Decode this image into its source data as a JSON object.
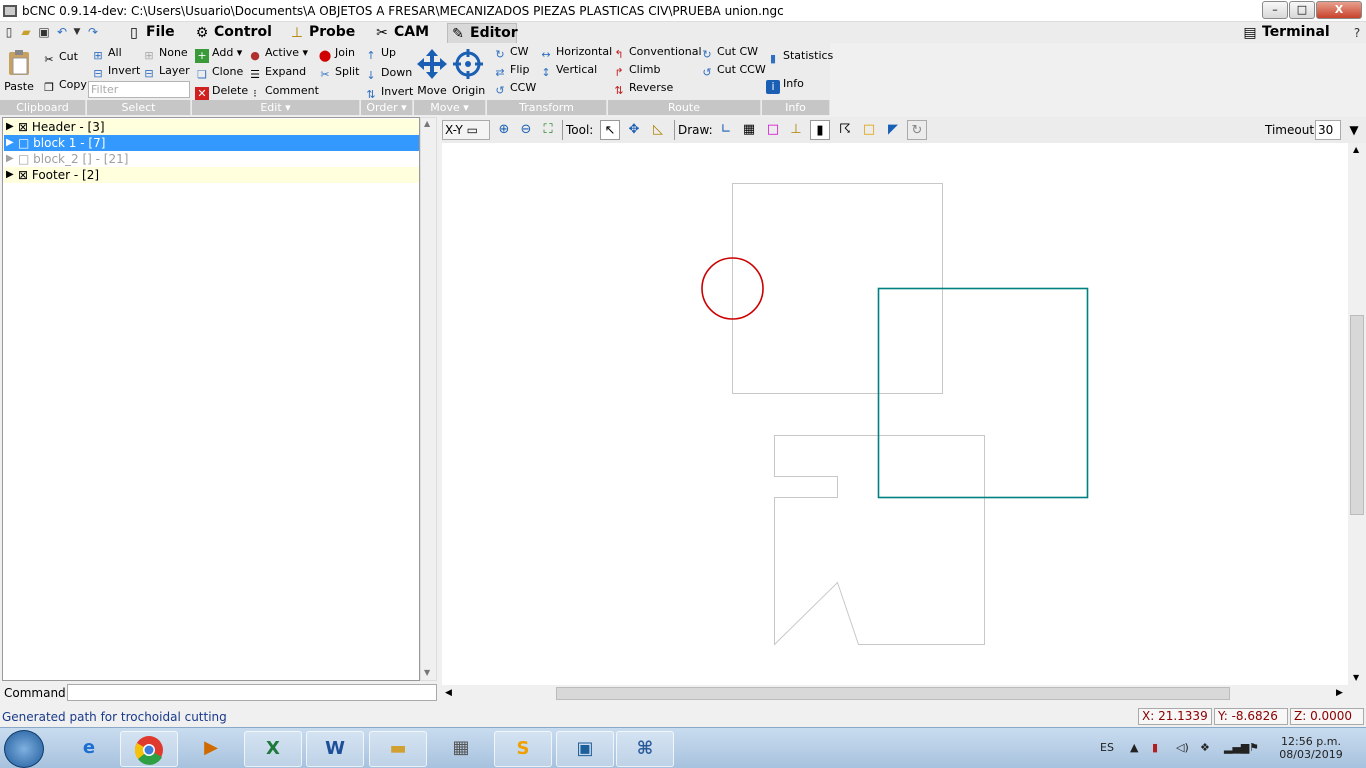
{
  "titlebar": {
    "title": "bCNC 0.9.14-dev: C:\\Users\\Usuario\\Documents\\A OBJETOS A FRESAR\\MECANIZADOS PIEZAS PLASTICAS CIV\\PRUEBA union.ngc",
    "min": "–",
    "max": "□",
    "close": "X"
  },
  "tabs": [
    {
      "label": "File"
    },
    {
      "label": "Control"
    },
    {
      "label": "Probe"
    },
    {
      "label": "CAM"
    },
    {
      "label": "Editor"
    }
  ],
  "terminal_tab": "Terminal",
  "ribbon": {
    "clipboard": {
      "paste": "Paste",
      "cut": "Cut",
      "copy": "Copy",
      "group": "Clipboard"
    },
    "select": {
      "all": "All",
      "none": "None",
      "invert": "Invert",
      "layer": "Layer",
      "filter_placeholder": "Filter",
      "group": "Select"
    },
    "edit": {
      "add": "Add",
      "active": "Active",
      "join": "Join",
      "clone": "Clone",
      "expand": "Expand",
      "split": "Split",
      "delete": "Delete",
      "comment": "Comment",
      "group": "Edit"
    },
    "order": {
      "up": "Up",
      "down": "Down",
      "invert": "Invert",
      "group": "Order"
    },
    "move": {
      "move": "Move",
      "origin": "Origin",
      "group": "Move"
    },
    "transform": {
      "cw": "CW",
      "horizontal": "Horizontal",
      "flip": "Flip",
      "vertical": "Vertical",
      "ccw": "CCW",
      "group": "Transform"
    },
    "route": {
      "conventional": "Conventional",
      "climb": "Climb",
      "reverse": "Reverse",
      "cut_cw": "Cut CW",
      "cut_ccw": "Cut CCW",
      "group": "Route"
    },
    "info": {
      "statistics": "Statistics",
      "info": "Info",
      "group": "Info"
    }
  },
  "tree": {
    "rows": [
      {
        "label": "⊠ Header - [3]",
        "state": "normal"
      },
      {
        "label": "□ block 1 - [7]",
        "state": "selected"
      },
      {
        "label": "□ block_2 [] - [21]",
        "state": "disabled"
      },
      {
        "label": "⊠ Footer - [2]",
        "state": "normal"
      }
    ]
  },
  "canvas_toolbar": {
    "view": "X-Y",
    "tool_label": "Tool:",
    "draw_label": "Draw:",
    "timeout_label": "Timeout:",
    "timeout_value": "30"
  },
  "command": {
    "label": "Command:",
    "value": ""
  },
  "status": {
    "message": "Generated path for trochoidal cutting",
    "x": "X: 21.1339",
    "y": "Y: -8.6826",
    "z": "Z: 0.0000"
  },
  "taskbar": {
    "lang": "ES",
    "time": "12:56 p.m.",
    "date": "08/03/2019"
  },
  "colors": {
    "selected": "#3399ff",
    "circle": "#cc0000",
    "square": "#008080",
    "tree_bg": "#ffffdd"
  }
}
